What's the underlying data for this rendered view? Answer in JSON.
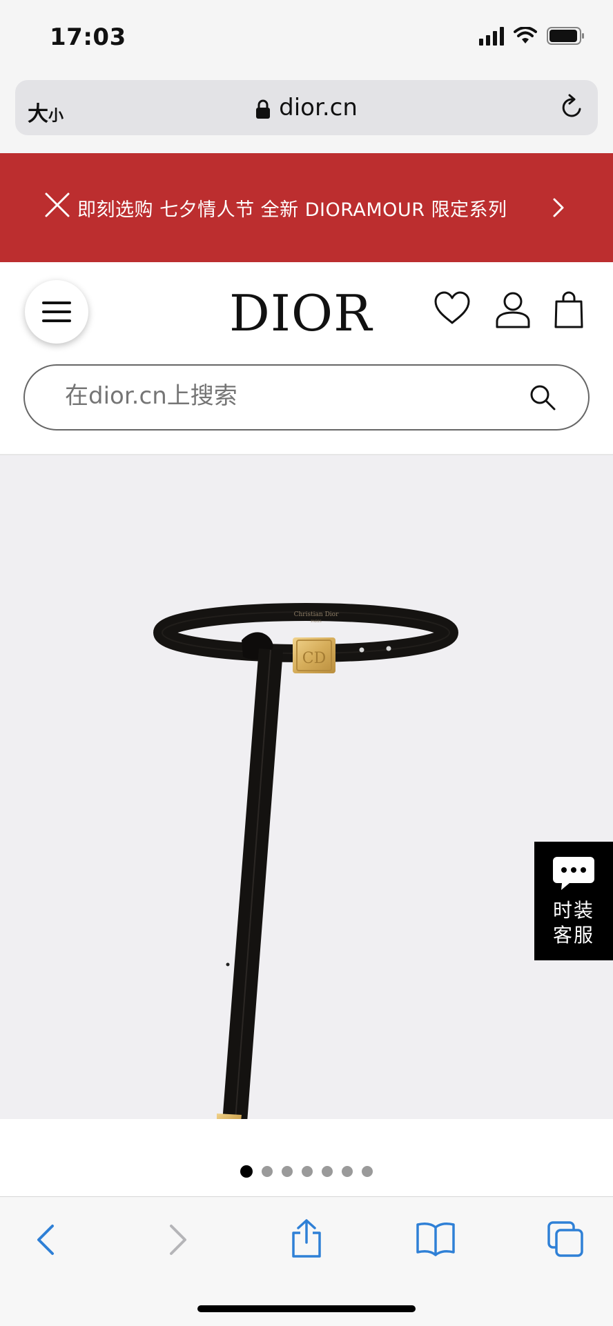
{
  "status_bar": {
    "time": "17:03"
  },
  "browser": {
    "size_label_big": "大",
    "size_label_small": "小",
    "url": "dior.cn"
  },
  "promo": {
    "text": "即刻选购 七夕情人节 全新 DIORAMOUR 限定系列"
  },
  "header": {
    "logo": "DIOR",
    "search_placeholder": "在dior.cn上搜索"
  },
  "product": {
    "brand_engraving": "Christian Dior",
    "brand_sub": "PARIS"
  },
  "chat": {
    "line1": "时装",
    "line2": "客服"
  },
  "carousel": {
    "total": 7,
    "active_index": 0
  },
  "colors": {
    "promo_bg": "#bc2e2f",
    "ios_blue": "#2f80d6",
    "product_bg": "#f0eff2"
  }
}
